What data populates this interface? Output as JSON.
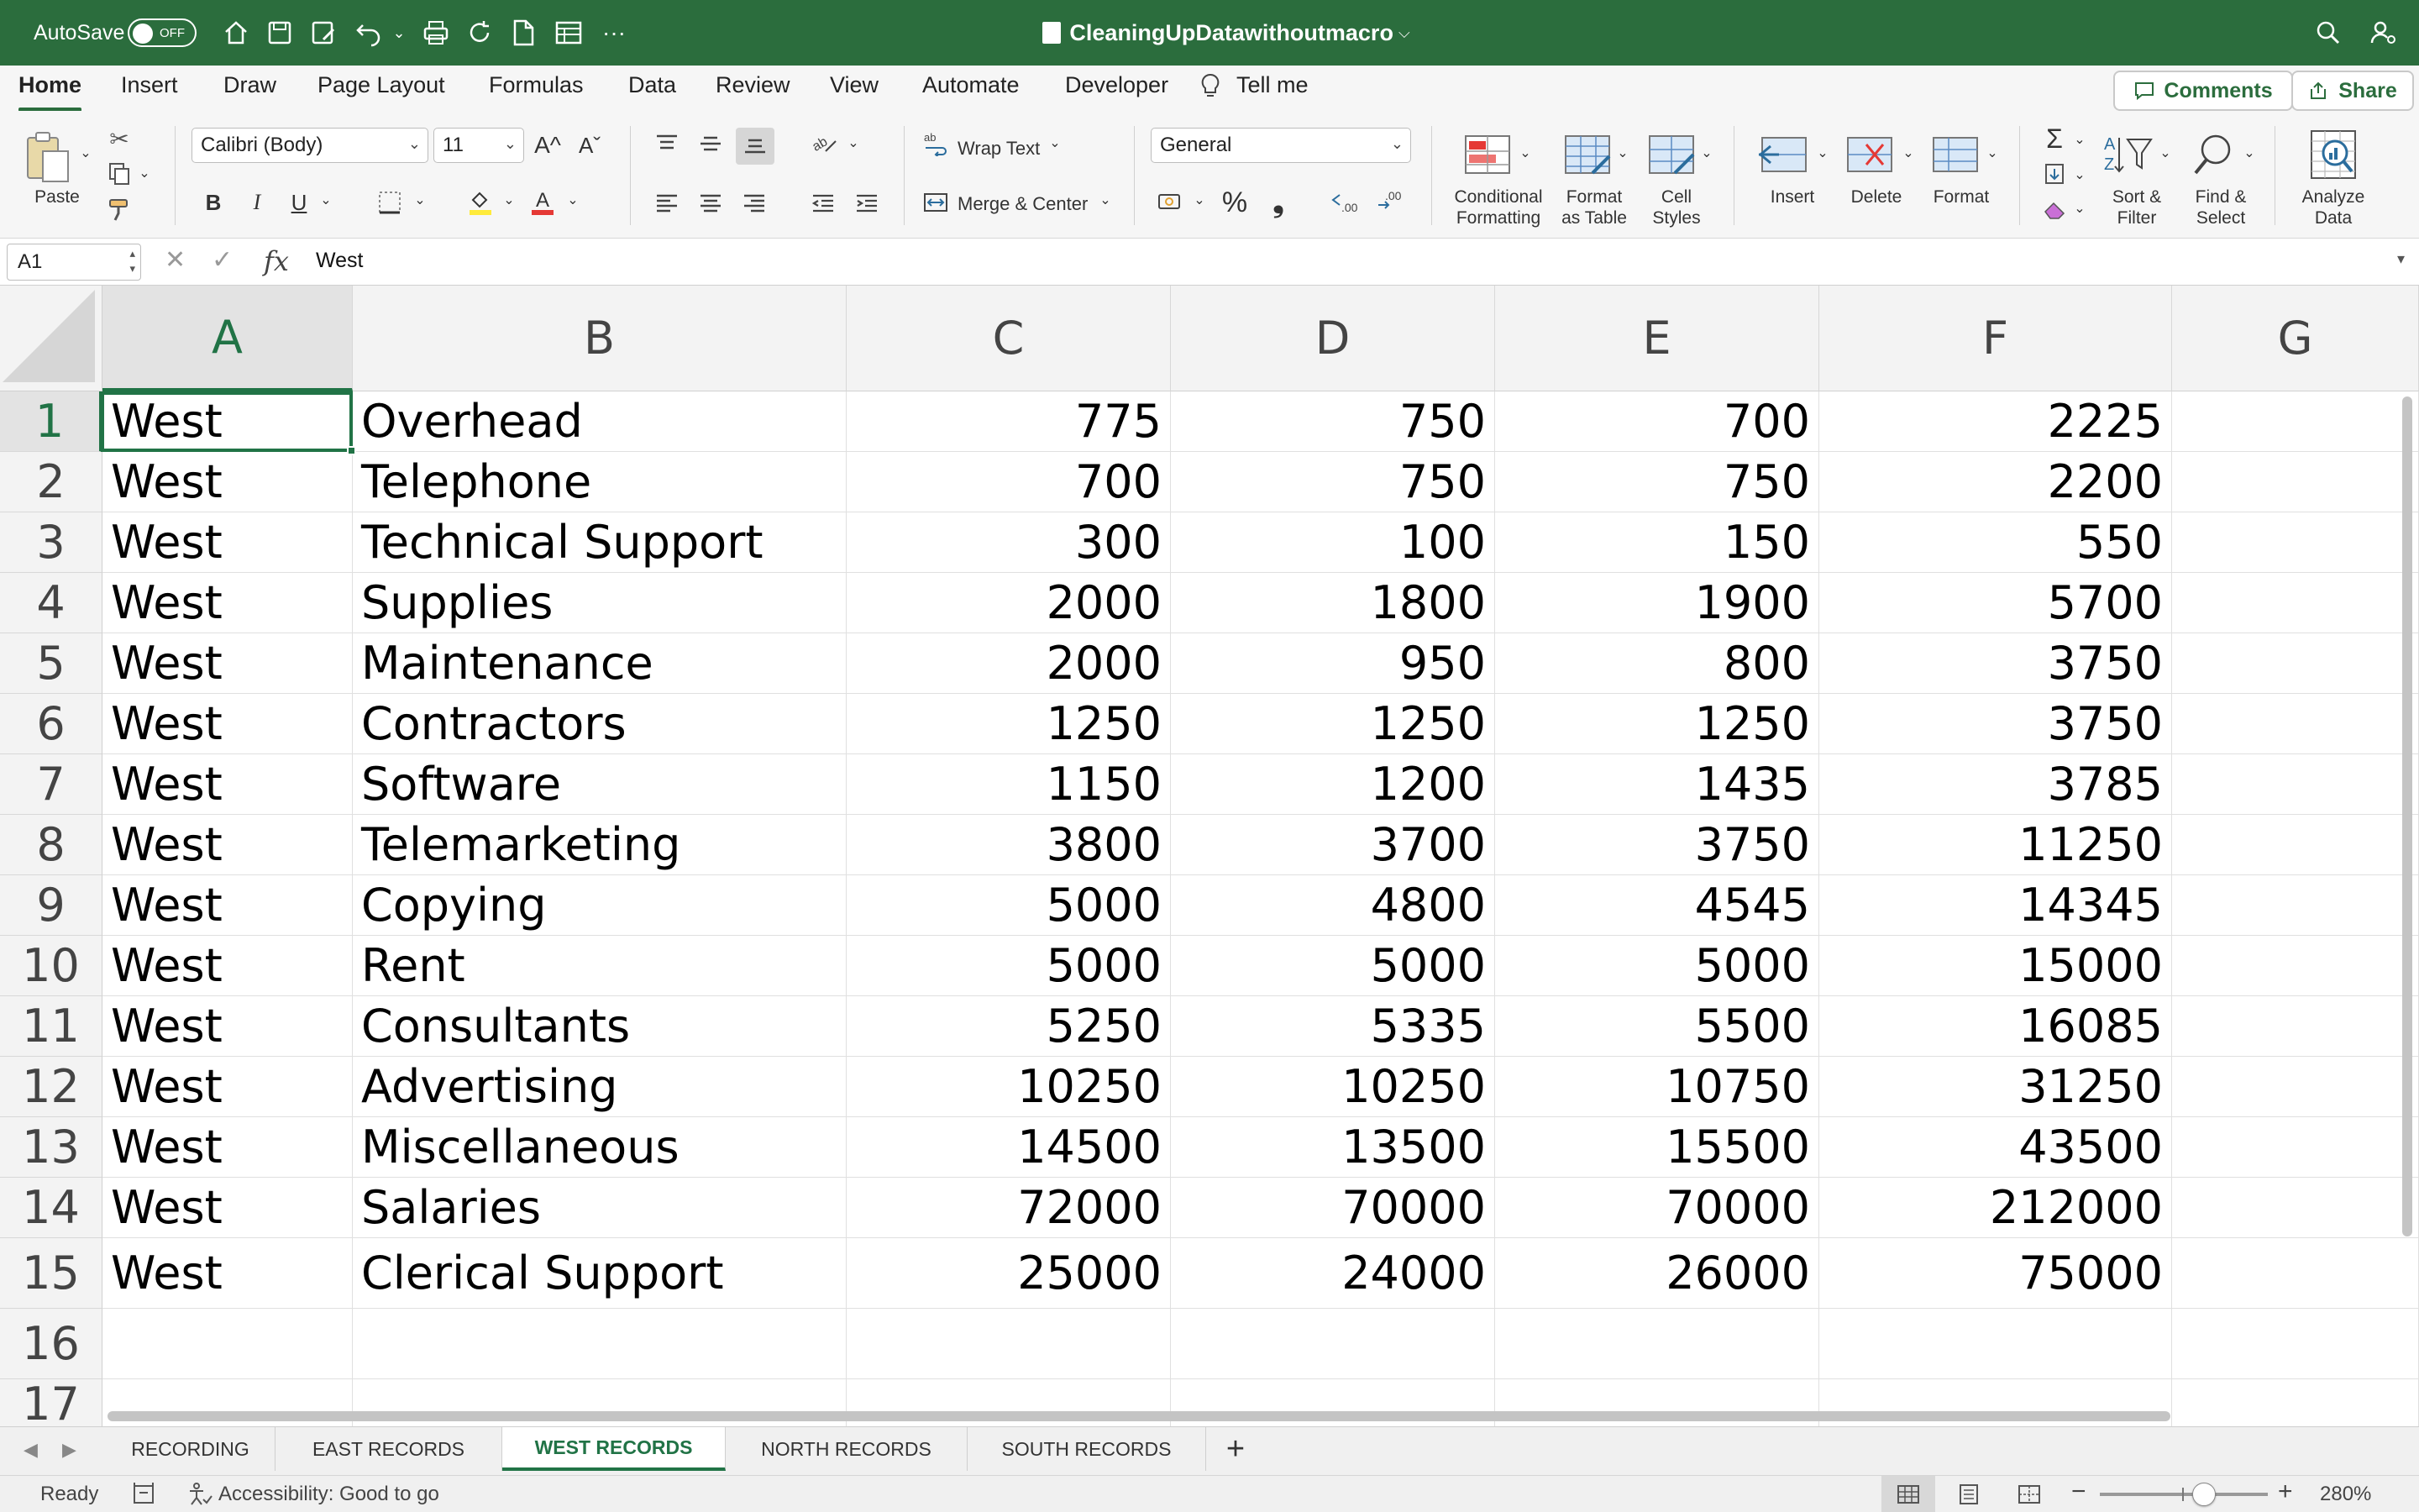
{
  "titlebar": {
    "autosave_label": "AutoSave",
    "autosave_state": "OFF",
    "doc_title": "CleaningUpDatawithoutmacro",
    "doc_chevron": "⌵"
  },
  "tabs": {
    "home": "Home",
    "insert": "Insert",
    "draw": "Draw",
    "page_layout": "Page Layout",
    "formulas": "Formulas",
    "data": "Data",
    "review": "Review",
    "view": "View",
    "automate": "Automate",
    "developer": "Developer",
    "tell_me": "Tell me",
    "comments": "Comments",
    "share": "Share"
  },
  "ribbon": {
    "paste": "Paste",
    "font_name": "Calibri (Body)",
    "font_size": "11",
    "grow_font": "A^",
    "shrink_font": "Aˇ",
    "bold": "B",
    "italic": "I",
    "underline": "U",
    "wrap_text": "Wrap Text",
    "merge_center": "Merge & Center",
    "number_format": "General",
    "percent": "%",
    "comma": "❟",
    "conditional_formatting_1": "Conditional",
    "conditional_formatting_2": "Formatting",
    "format_as_table_1": "Format",
    "format_as_table_2": "as Table",
    "cell_styles_1": "Cell",
    "cell_styles_2": "Styles",
    "insert": "Insert",
    "delete": "Delete",
    "format": "Format",
    "sort_filter_1": "Sort &",
    "sort_filter_2": "Filter",
    "find_select_1": "Find &",
    "find_select_2": "Select",
    "analyze_data_1": "Analyze",
    "analyze_data_2": "Data"
  },
  "formula_bar": {
    "cell_ref": "A1",
    "cancel": "✕",
    "enter": "✓",
    "fx": "fx",
    "value": "West"
  },
  "grid": {
    "columns": [
      "A",
      "B",
      "C",
      "D",
      "E",
      "F",
      "G"
    ],
    "rows": [
      {
        "n": "1",
        "a": "West",
        "b": "Overhead",
        "c": "775",
        "d": "750",
        "e": "700",
        "f": "2225"
      },
      {
        "n": "2",
        "a": "West",
        "b": "Telephone",
        "c": "700",
        "d": "750",
        "e": "750",
        "f": "2200"
      },
      {
        "n": "3",
        "a": "West",
        "b": "Technical Support",
        "c": "300",
        "d": "100",
        "e": "150",
        "f": "550"
      },
      {
        "n": "4",
        "a": "West",
        "b": "Supplies",
        "c": "2000",
        "d": "1800",
        "e": "1900",
        "f": "5700"
      },
      {
        "n": "5",
        "a": "West",
        "b": "Maintenance",
        "c": "2000",
        "d": "950",
        "e": "800",
        "f": "3750"
      },
      {
        "n": "6",
        "a": "West",
        "b": "Contractors",
        "c": "1250",
        "d": "1250",
        "e": "1250",
        "f": "3750"
      },
      {
        "n": "7",
        "a": "West",
        "b": "Software",
        "c": "1150",
        "d": "1200",
        "e": "1435",
        "f": "3785"
      },
      {
        "n": "8",
        "a": "West",
        "b": "Telemarketing",
        "c": "3800",
        "d": "3700",
        "e": "3750",
        "f": "11250"
      },
      {
        "n": "9",
        "a": "West",
        "b": "Copying",
        "c": "5000",
        "d": "4800",
        "e": "4545",
        "f": "14345"
      },
      {
        "n": "10",
        "a": "West",
        "b": "Rent",
        "c": "5000",
        "d": "5000",
        "e": "5000",
        "f": "15000"
      },
      {
        "n": "11",
        "a": "West",
        "b": "Consultants",
        "c": "5250",
        "d": "5335",
        "e": "5500",
        "f": "16085"
      },
      {
        "n": "12",
        "a": "West",
        "b": "Advertising",
        "c": "10250",
        "d": "10250",
        "e": "10750",
        "f": "31250"
      },
      {
        "n": "13",
        "a": "West",
        "b": "Miscellaneous",
        "c": "14500",
        "d": "13500",
        "e": "15500",
        "f": "43500"
      },
      {
        "n": "14",
        "a": "West",
        "b": "Salaries",
        "c": "72000",
        "d": "70000",
        "e": "70000",
        "f": "212000"
      },
      {
        "n": "15",
        "a": "West",
        "b": "Clerical Support",
        "c": "25000",
        "d": "24000",
        "e": "26000",
        "f": "75000"
      },
      {
        "n": "16",
        "a": "",
        "b": "",
        "c": "",
        "d": "",
        "e": "",
        "f": ""
      },
      {
        "n": "17",
        "a": "",
        "b": "",
        "c": "",
        "d": "",
        "e": "",
        "f": ""
      }
    ]
  },
  "sheets": [
    "RECORDING",
    "EAST RECORDS",
    "WEST RECORDS",
    "NORTH RECORDS",
    "SOUTH RECORDS"
  ],
  "active_sheet": "WEST RECORDS",
  "add_sheet": "+",
  "status": {
    "ready": "Ready",
    "accessibility": "Accessibility: Good to go",
    "zoom_minus": "−",
    "zoom_plus": "+",
    "zoom": "280%",
    "zoom_level": 0.62
  },
  "colors": {
    "accent": "#2b6d3d",
    "excel_green": "#217346"
  }
}
